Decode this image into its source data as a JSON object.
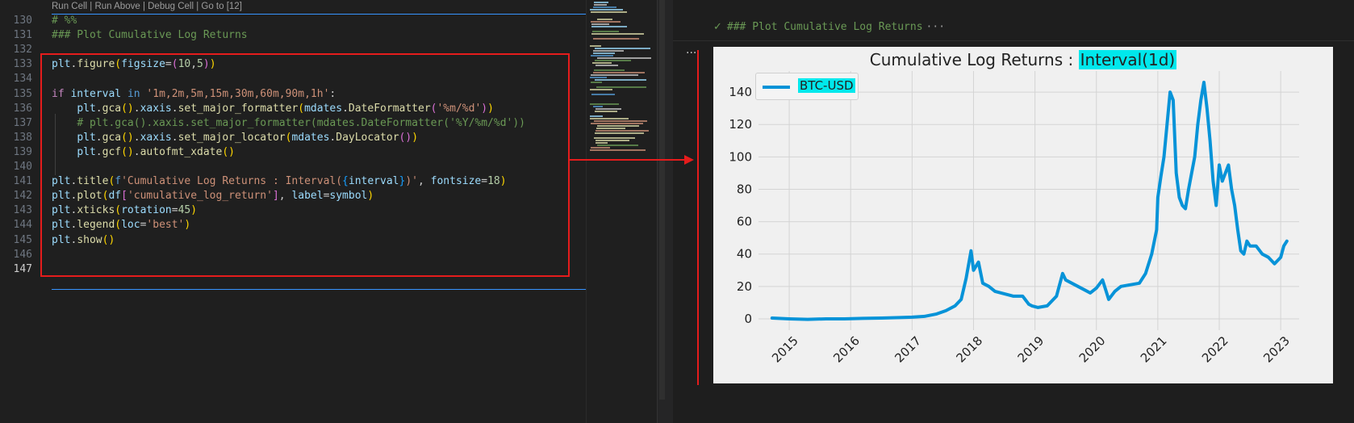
{
  "codelens": "Run Cell | Run Above | Debug Cell | Go to [12]",
  "code_lines": [
    {
      "n": "130",
      "active": false,
      "tokens": [
        [
          "cm",
          "# %%"
        ]
      ]
    },
    {
      "n": "131",
      "active": false,
      "tokens": [
        [
          "cm",
          "### Plot Cumulative Log Returns"
        ]
      ]
    },
    {
      "n": "132",
      "active": false,
      "tokens": []
    },
    {
      "n": "133",
      "active": false,
      "tokens": [
        [
          "var",
          "plt"
        ],
        [
          "",
          "."
        ],
        [
          "fn",
          "figure"
        ],
        [
          "b1",
          "("
        ],
        [
          "var",
          "figsize"
        ],
        [
          "",
          "="
        ],
        [
          "b2",
          "("
        ],
        [
          "num",
          "10"
        ],
        [
          "",
          ","
        ],
        [
          "num",
          "5"
        ],
        [
          "b2",
          ")"
        ],
        [
          "b1",
          ")"
        ]
      ]
    },
    {
      "n": "134",
      "active": false,
      "tokens": []
    },
    {
      "n": "135",
      "active": false,
      "tokens": [
        [
          "ctl",
          "if"
        ],
        [
          "",
          " "
        ],
        [
          "var",
          "interval"
        ],
        [
          "",
          " "
        ],
        [
          "kw",
          "in"
        ],
        [
          "",
          " "
        ],
        [
          "str",
          "'1m,2m,5m,15m,30m,60m,90m,1h'"
        ],
        [
          "",
          ":"
        ]
      ]
    },
    {
      "n": "136",
      "active": false,
      "tokens": [
        [
          "",
          "    "
        ],
        [
          "var",
          "plt"
        ],
        [
          "",
          "."
        ],
        [
          "fn",
          "gca"
        ],
        [
          "b1",
          "()"
        ],
        [
          "",
          "."
        ],
        [
          "var",
          "xaxis"
        ],
        [
          "",
          "."
        ],
        [
          "fn",
          "set_major_formatter"
        ],
        [
          "b1",
          "("
        ],
        [
          "var",
          "mdates"
        ],
        [
          "",
          "."
        ],
        [
          "fn",
          "DateFormatter"
        ],
        [
          "b2",
          "("
        ],
        [
          "str",
          "'%m/%d'"
        ],
        [
          "b2",
          ")"
        ],
        [
          "b1",
          ")"
        ]
      ]
    },
    {
      "n": "137",
      "active": false,
      "tokens": [
        [
          "",
          "    "
        ],
        [
          "cm",
          "# plt.gca().xaxis.set_major_formatter(mdates.DateFormatter('%Y/%m/%d'))"
        ]
      ]
    },
    {
      "n": "138",
      "active": false,
      "tokens": [
        [
          "",
          "    "
        ],
        [
          "var",
          "plt"
        ],
        [
          "",
          "."
        ],
        [
          "fn",
          "gca"
        ],
        [
          "b1",
          "()"
        ],
        [
          "",
          "."
        ],
        [
          "var",
          "xaxis"
        ],
        [
          "",
          "."
        ],
        [
          "fn",
          "set_major_locator"
        ],
        [
          "b1",
          "("
        ],
        [
          "var",
          "mdates"
        ],
        [
          "",
          "."
        ],
        [
          "fn",
          "DayLocator"
        ],
        [
          "b2",
          "()"
        ],
        [
          "b1",
          ")"
        ]
      ]
    },
    {
      "n": "139",
      "active": false,
      "tokens": [
        [
          "",
          "    "
        ],
        [
          "var",
          "plt"
        ],
        [
          "",
          "."
        ],
        [
          "fn",
          "gcf"
        ],
        [
          "b1",
          "()"
        ],
        [
          "",
          "."
        ],
        [
          "fn",
          "autofmt_xdate"
        ],
        [
          "b1",
          "()"
        ]
      ]
    },
    {
      "n": "140",
      "active": false,
      "tokens": []
    },
    {
      "n": "141",
      "active": false,
      "tokens": [
        [
          "var",
          "plt"
        ],
        [
          "",
          "."
        ],
        [
          "fn",
          "title"
        ],
        [
          "b1",
          "("
        ],
        [
          "kw",
          "f"
        ],
        [
          "str",
          "'Cumulative Log Returns : Interval("
        ],
        [
          "b3",
          "{"
        ],
        [
          "var",
          "interval"
        ],
        [
          "b3",
          "}"
        ],
        [
          "str",
          ")'"
        ],
        [
          "",
          ", "
        ],
        [
          "var",
          "fontsize"
        ],
        [
          "",
          "="
        ],
        [
          "num",
          "18"
        ],
        [
          "b1",
          ")"
        ]
      ]
    },
    {
      "n": "142",
      "active": false,
      "tokens": [
        [
          "var",
          "plt"
        ],
        [
          "",
          "."
        ],
        [
          "fn",
          "plot"
        ],
        [
          "b1",
          "("
        ],
        [
          "var",
          "df"
        ],
        [
          "b2",
          "["
        ],
        [
          "str",
          "'cumulative_log_return'"
        ],
        [
          "b2",
          "]"
        ],
        [
          "",
          ", "
        ],
        [
          "var",
          "label"
        ],
        [
          "",
          "="
        ],
        [
          "var",
          "symbol"
        ],
        [
          "b1",
          ")"
        ]
      ]
    },
    {
      "n": "143",
      "active": false,
      "tokens": [
        [
          "var",
          "plt"
        ],
        [
          "",
          "."
        ],
        [
          "fn",
          "xticks"
        ],
        [
          "b1",
          "("
        ],
        [
          "var",
          "rotation"
        ],
        [
          "",
          "="
        ],
        [
          "num",
          "45"
        ],
        [
          "b1",
          ")"
        ]
      ]
    },
    {
      "n": "144",
      "active": false,
      "tokens": [
        [
          "var",
          "plt"
        ],
        [
          "",
          "."
        ],
        [
          "fn",
          "legend"
        ],
        [
          "b1",
          "("
        ],
        [
          "var",
          "loc"
        ],
        [
          "",
          "="
        ],
        [
          "str",
          "'best'"
        ],
        [
          "b1",
          ")"
        ]
      ]
    },
    {
      "n": "145",
      "active": false,
      "tokens": [
        [
          "var",
          "plt"
        ],
        [
          "",
          "."
        ],
        [
          "fn",
          "show"
        ],
        [
          "b1",
          "()"
        ]
      ]
    },
    {
      "n": "146",
      "active": false,
      "tokens": []
    },
    {
      "n": "147",
      "active": true,
      "tokens": []
    }
  ],
  "output": {
    "header_text": "### Plot Cumulative Log Returns",
    "ellipsis": "···",
    "side_dots": "···"
  },
  "colors": {
    "selection_border": "#e51c1c",
    "series": "#0793d8",
    "highlight": "#00e8ec",
    "plot_bg": "#f0f0f0"
  },
  "chart_data": {
    "type": "line",
    "title": "Cumulative Log Returns : ",
    "title_highlight": "Interval(1d)",
    "xlabel": "",
    "ylabel": "",
    "x_ticks": [
      "2015",
      "2016",
      "2017",
      "2018",
      "2019",
      "2020",
      "2021",
      "2022",
      "2023"
    ],
    "y_ticks": [
      "0",
      "20",
      "40",
      "60",
      "80",
      "100",
      "120",
      "140"
    ],
    "ylim": [
      -7,
      153
    ],
    "xlim": [
      2014.5,
      2023.3
    ],
    "grid": true,
    "legend_position": "top-left",
    "series": [
      {
        "name": "BTC-USD",
        "x": [
          2014.72,
          2015.0,
          2015.3,
          2015.6,
          2015.9,
          2016.2,
          2016.5,
          2016.8,
          2017.0,
          2017.2,
          2017.4,
          2017.55,
          2017.7,
          2017.8,
          2017.88,
          2017.96,
          2018.0,
          2018.08,
          2018.15,
          2018.25,
          2018.35,
          2018.45,
          2018.55,
          2018.65,
          2018.8,
          2018.9,
          2018.95,
          2019.05,
          2019.2,
          2019.35,
          2019.45,
          2019.5,
          2019.6,
          2019.7,
          2019.8,
          2019.9,
          2020.0,
          2020.1,
          2020.2,
          2020.3,
          2020.4,
          2020.55,
          2020.7,
          2020.8,
          2020.9,
          2020.98,
          2021.0,
          2021.05,
          2021.1,
          2021.15,
          2021.2,
          2021.25,
          2021.3,
          2021.35,
          2021.4,
          2021.45,
          2021.5,
          2021.55,
          2021.6,
          2021.65,
          2021.7,
          2021.75,
          2021.8,
          2021.85,
          2021.9,
          2021.95,
          2022.0,
          2022.05,
          2022.1,
          2022.15,
          2022.2,
          2022.25,
          2022.3,
          2022.35,
          2022.4,
          2022.45,
          2022.5,
          2022.6,
          2022.7,
          2022.8,
          2022.9,
          2023.0,
          2023.05,
          2023.1
        ],
        "y": [
          0.5,
          0,
          -0.3,
          0,
          0,
          0.3,
          0.5,
          0.8,
          1,
          1.5,
          3,
          5,
          8,
          12,
          25,
          42,
          30,
          35,
          22,
          20,
          17,
          16,
          15,
          14,
          14,
          9,
          8,
          7,
          8,
          14,
          28,
          24,
          22,
          20,
          18,
          16,
          19,
          24,
          12,
          17,
          20,
          21,
          22,
          28,
          40,
          55,
          75,
          88,
          100,
          120,
          140,
          135,
          90,
          75,
          70,
          68,
          80,
          90,
          100,
          120,
          135,
          146,
          130,
          110,
          85,
          70,
          95,
          85,
          90,
          95,
          80,
          70,
          55,
          42,
          40,
          48,
          45,
          45,
          40,
          38,
          34,
          38,
          45,
          48
        ]
      }
    ]
  }
}
